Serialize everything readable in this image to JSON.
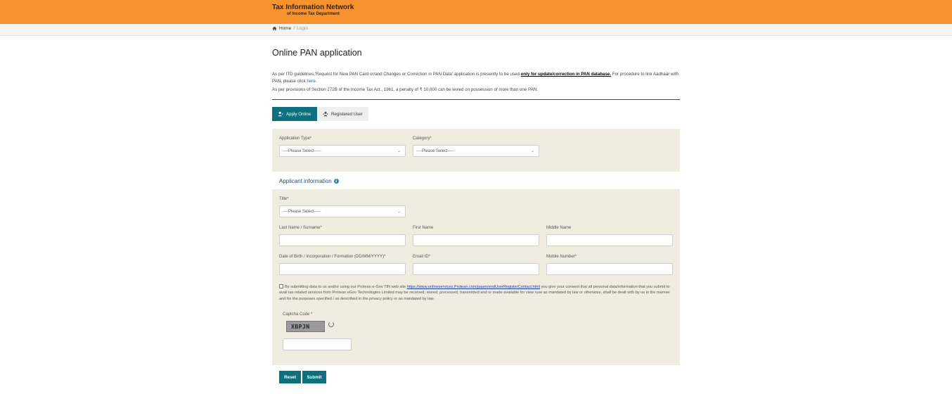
{
  "header": {
    "logo_line1": "Tax Information Network",
    "logo_line2": "of Income Tax Department",
    "bg_color": "#f7932e"
  },
  "breadcrumb": {
    "home": "Home",
    "separator": "/",
    "current": "Login"
  },
  "page": {
    "title": "Online PAN application",
    "info_pre": "As per ITD guidelines,'Request for New PAN Card or/and Changes or Correction in PAN Data' application is presently to be used ",
    "info_link": "only for update/correction in PAN database.",
    "info_mid": " For procedure to link Aadhaar with PAN, please click ",
    "info_here": "here",
    "info_end": ".",
    "info2": "As per provisions of Section 272B of the Income Tax Act., 1961, a penalty of ₹ 10,000 can be levied on possession of more than one PAN."
  },
  "tabs": [
    {
      "label": "Apply Online",
      "icon": "person-edit-icon",
      "active": true
    },
    {
      "label": "Registered User",
      "icon": "user-group-icon",
      "active": false
    }
  ],
  "form": {
    "application_type_label": "Application Type*",
    "application_type_value": "----Please Select-----",
    "category_label": "Category*",
    "category_value": "----Please Select-----",
    "applicant_info_title": "Applicant information",
    "title_label": "Title*",
    "title_value": "----Please Select-----",
    "last_name_label": "Last Name / Surname*",
    "first_name_label": "First Name",
    "middle_name_label": "Middle Name",
    "dob_label": "Date of Birth / Incorporation / Formation (DD/MM/YYYY)*",
    "email_label": "Email ID*",
    "mobile_label": "Mobile Number*",
    "consent_pre": "By submitting data to us and/or using our Protean e-Gov TIN web site ",
    "consent_link": "https://www.onlineservices.Protean.com/paam/endUserRegisterContact.html",
    "consent_post": " you give your consent that all personal data/information that you submit to avail tax related services from Protean eGov Technologies Limited may be received, stored, processed, transmitted and or made available for view /use as mandated by law or otherwise, shall be dealt with by us in the manner and for the purposes specified / as described in the privacy policy or as mandated by law.",
    "captcha_label": "Captcha Code *",
    "captcha_text": "XBPJN",
    "reset_label": "Reset",
    "submit_label": "Submit"
  },
  "colors": {
    "accent": "#0f6f7e",
    "panel": "#eeede0"
  }
}
